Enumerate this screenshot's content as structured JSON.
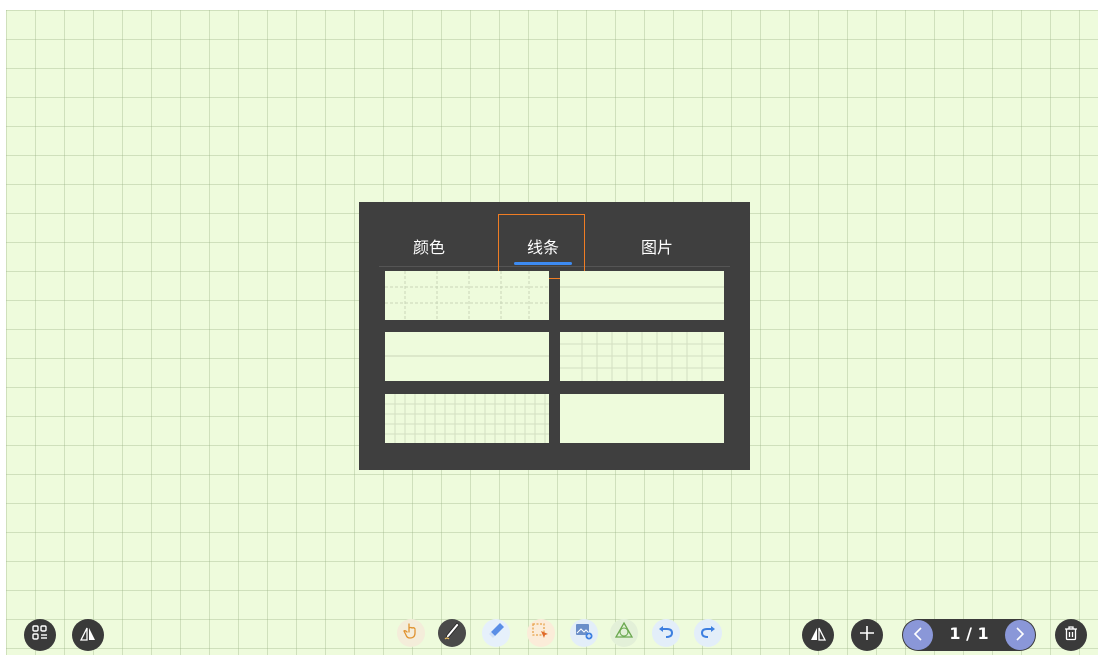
{
  "popup": {
    "tabs": [
      {
        "label": "颜色"
      },
      {
        "label": "线条"
      },
      {
        "label": "图片"
      }
    ],
    "selected_tab": "线条",
    "thumbnails": [
      "grid-dashed",
      "horizontal-lines",
      "plain-with-line",
      "fine-grid",
      "dense-grid",
      "blank"
    ]
  },
  "pager": {
    "label": "1 / 1"
  },
  "colors": {
    "board_background": "#eefbdc",
    "popup_background": "#3f3f3f",
    "tab_underline": "#3d8bf2",
    "highlight_border": "#ef7d24",
    "button_dark": "#3a3a3a",
    "pager_arrow": "#8a97d8"
  },
  "icons": {
    "left": [
      "apps-icon",
      "mirror-icon"
    ],
    "center": [
      "hand-icon",
      "pen-icon",
      "eraser-icon",
      "select-icon",
      "insert-image-icon",
      "shape-icon",
      "undo-icon",
      "redo-icon"
    ],
    "right": [
      "mirror-icon",
      "add-page-icon",
      "prev-page-icon",
      "next-page-icon",
      "delete-icon"
    ]
  }
}
